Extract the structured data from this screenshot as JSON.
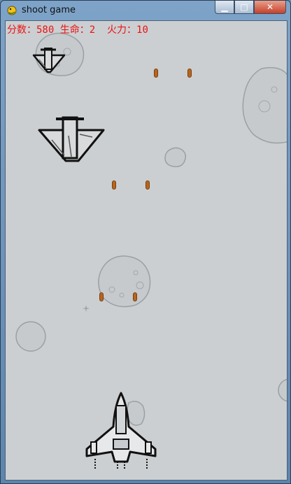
{
  "window": {
    "title": "shoot game",
    "icons": [
      "pygame-snake-icon",
      "minimize-icon",
      "maximize-icon",
      "close-icon"
    ]
  },
  "hud": {
    "score_label": "分数：",
    "score": "580",
    "lives_label": "生命：",
    "lives": "2",
    "firepower_label": "火力：",
    "firepower": "10",
    "color": "#ee1111"
  },
  "colors": {
    "background": "#cbcfd2",
    "bullet": "#b8651e"
  }
}
